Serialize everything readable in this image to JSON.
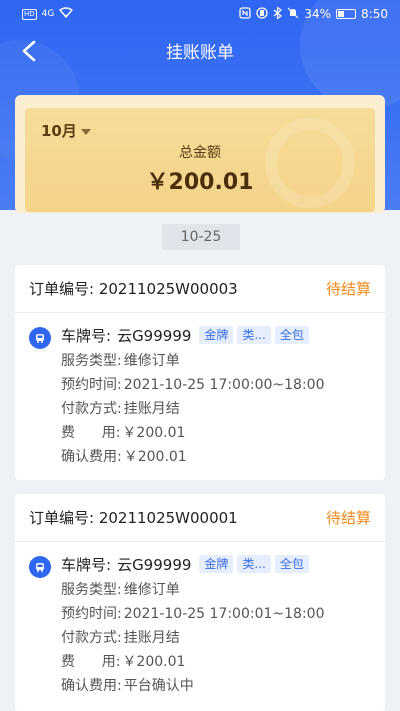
{
  "status_bar": {
    "left_hd": "HD",
    "left_signal": "4G",
    "battery_percent": "34%",
    "time": "8:50"
  },
  "nav": {
    "title": "挂账账单"
  },
  "summary": {
    "month": "10月",
    "total_label": "总金额",
    "total_amount": "￥200.01"
  },
  "date_chip": "10-25",
  "orders": [
    {
      "order_no": "订单编号:  20211025W00003",
      "status": "待结算",
      "plate_label": "车牌号:",
      "plate_value": "云G99999",
      "tags": [
        "金牌",
        "类...",
        "全包"
      ],
      "rows": [
        {
          "key": "服务类型:",
          "val": "维修订单"
        },
        {
          "key": "预约时间:",
          "val": "2021-10-25 17:00:00~18:00"
        },
        {
          "key": "付款方式:",
          "val": "挂账月结"
        },
        {
          "key": "费      用:",
          "val": "￥200.01"
        },
        {
          "key": "确认费用:",
          "val": "￥200.01"
        }
      ]
    },
    {
      "order_no": "订单编号:  20211025W00001",
      "status": "待结算",
      "plate_label": "车牌号:",
      "plate_value": "云G99999",
      "tags": [
        "金牌",
        "类...",
        "全包"
      ],
      "rows": [
        {
          "key": "服务类型:",
          "val": "维修订单"
        },
        {
          "key": "预约时间:",
          "val": "2021-10-25 17:00:01~18:00"
        },
        {
          "key": "付款方式:",
          "val": "挂账月结"
        },
        {
          "key": "费      用:",
          "val": "￥200.01"
        },
        {
          "key": "确认费用:",
          "val": "平台确认中"
        }
      ]
    }
  ],
  "colors": {
    "header_blue": "#2f66f2",
    "status_orange": "#f08a1c",
    "summary_gold": "#f5d38a"
  }
}
